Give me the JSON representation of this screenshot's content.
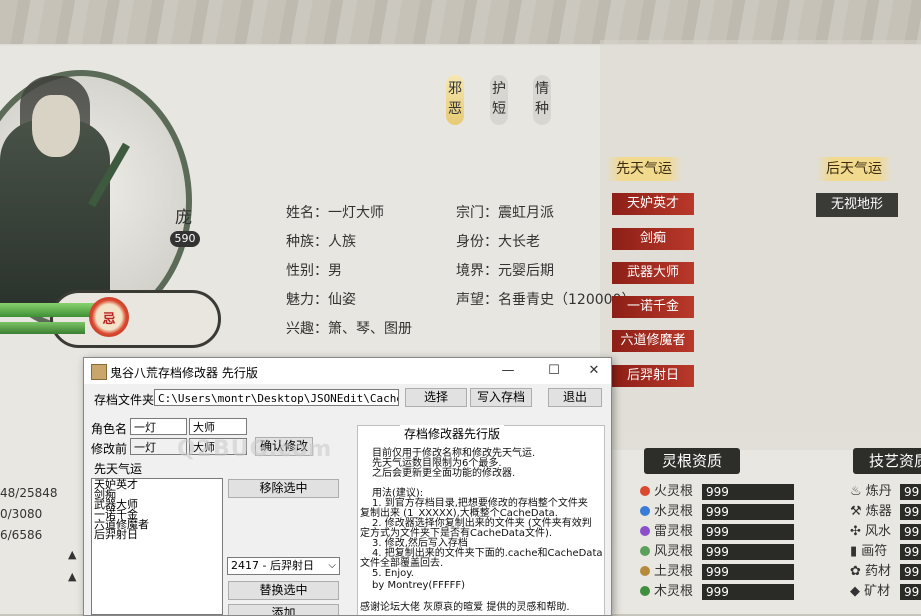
{
  "tabs": [
    {
      "label": "邪\n恶",
      "active": true
    },
    {
      "label": "护\n短",
      "active": false
    },
    {
      "label": "情\n种",
      "active": false
    }
  ],
  "character": {
    "age_char": "庞",
    "age_value": "590",
    "seal_text": "忌",
    "info": [
      {
        "label": "姓名：一灯大师"
      },
      {
        "label": "种族：人族"
      },
      {
        "label": "性别：男"
      },
      {
        "label": "魅力：仙姿"
      },
      {
        "label": "兴趣：箫、琴、图册"
      },
      {
        "label": "宗门：震虹月派"
      },
      {
        "label": "身份：大长老"
      },
      {
        "label": "境界：元婴后期"
      },
      {
        "label": "声望：名垂青史（120000）"
      }
    ],
    "left_stats": [
      "48/25848",
      "0/3080",
      "6/6586"
    ]
  },
  "innate_fate": {
    "title": "先天气运",
    "items": [
      "天妒英才",
      "剑痴",
      "武器大师",
      "一诺千金",
      "六道修魔者",
      "后羿射日"
    ]
  },
  "later_fate": {
    "title": "后天气运",
    "items": [
      "无视地形"
    ]
  },
  "spirit_roots": {
    "title": "灵根资质",
    "rows": [
      {
        "name": "火灵根",
        "value": "999",
        "color": "#d9482f"
      },
      {
        "name": "水灵根",
        "value": "999",
        "color": "#3a7bd5"
      },
      {
        "name": "雷灵根",
        "value": "999",
        "color": "#8a4fc9"
      },
      {
        "name": "风灵根",
        "value": "999",
        "color": "#5aa05a"
      },
      {
        "name": "土灵根",
        "value": "999",
        "color": "#b58a3a"
      },
      {
        "name": "木灵根",
        "value": "999",
        "color": "#3f8f3f"
      }
    ]
  },
  "skills": {
    "title": "技艺资质",
    "rows": [
      {
        "name": "炼丹",
        "value": "99"
      },
      {
        "name": "炼器",
        "value": "99"
      },
      {
        "name": "风水",
        "value": "99"
      },
      {
        "name": "画符",
        "value": "99"
      },
      {
        "name": "药材",
        "value": "99"
      },
      {
        "name": "矿材",
        "value": "99"
      }
    ]
  },
  "dialog": {
    "title": "鬼谷八荒存档修改器 先行版",
    "minimize": "—",
    "maximize": "☐",
    "close": "✕",
    "save_file_label": "存档文件夹",
    "save_path": "C:\\Users\\montr\\Desktop\\JSONEdit\\CacheData\\新建文件夹",
    "select_btn": "选择",
    "write_btn": "写入存档",
    "exit_btn": "退出",
    "role_name_label": "角色名",
    "role_first": "一灯",
    "role_last": "大师",
    "before_label": "修改前",
    "before_first": "一灯",
    "before_last": "大师",
    "confirm_btn": "确认修改",
    "fate_label": "先天气运",
    "fate_list": [
      "天妒英才",
      "剑痴",
      "武器大师",
      "一诺千金",
      "六道修魔者",
      "后羿射日"
    ],
    "remove_btn": "移除选中",
    "select_value": "2417 - 后羿射日",
    "replace_btn": "替换选中",
    "add_btn": "添加",
    "group_title": "存档修改器先行版",
    "help_lines": [
      "目前仅用于修改名称和修改先天气运.",
      "先天气运数目限制为6个最多.",
      "之后会更新更全面功能的修改器.",
      "",
      "用法(建议):",
      "1. 到官方存档目录,把想要修改的存档整个文件夹",
      "复制出来 (1_XXXXX),大概整个CacheData.",
      "2. 修改器选择你复制出来的文件夹 (文件夹有效判",
      "定方式为文件夹下是否有CacheData文件).",
      "3. 修改,然后写入存档",
      "4. 把复制出来的文件夹下面的.cache和CacheData",
      "文件全部覆盖回去.",
      "5. Enjoy.",
      "          by  Montrey(FFFFF)",
      "",
      "感谢论坛大佬 灰原哀的暄爱 提供的灵感和帮助."
    ],
    "watermark": "Q2BUG.com"
  }
}
